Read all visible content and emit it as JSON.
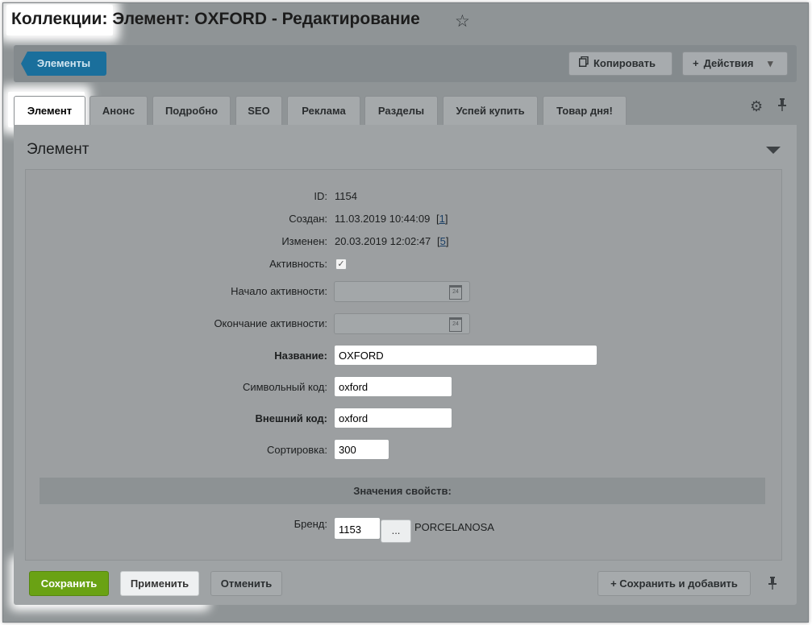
{
  "header": {
    "title_part1": "Коллекции:",
    "title_part2": " Элемент: OXFORD - Редактирование",
    "star_icon": "☆"
  },
  "toolbar": {
    "back_label": "Элементы",
    "copy_label": "Копировать",
    "actions_label": "Действия",
    "actions_arrow": "▾",
    "plus_icon": "+"
  },
  "tabs": [
    {
      "label": "Элемент",
      "active": true
    },
    {
      "label": "Анонс"
    },
    {
      "label": "Подробно"
    },
    {
      "label": "SEO"
    },
    {
      "label": "Реклама"
    },
    {
      "label": "Разделы"
    },
    {
      "label": "Успей купить"
    },
    {
      "label": "Товар дня!"
    }
  ],
  "panel": {
    "title": "Элемент"
  },
  "form": {
    "id_label": "ID:",
    "id_value": "1154",
    "created_label": "Создан:",
    "created_value": "11.03.2019 10:44:09",
    "created_link": "1",
    "modified_label": "Изменен:",
    "modified_value": "20.03.2019 12:02:47",
    "modified_link": "5",
    "active_label": "Активность:",
    "active_checked": true,
    "active_from_label": "Начало активности:",
    "active_from_value": "",
    "active_to_label": "Окончание активности:",
    "active_to_value": "",
    "calendar_day": "24",
    "name_label": "Название:",
    "name_value": "OXFORD",
    "code_label": "Символьный код:",
    "code_value": "oxford",
    "xml_id_label": "Внешний код:",
    "xml_id_value": "oxford",
    "sort_label": "Сортировка:",
    "sort_value": "300",
    "properties_section": "Значения свойств:",
    "brand_label": "Бренд:",
    "brand_value": "1153",
    "brand_button": "...",
    "brand_name": "PORCELANOSA"
  },
  "footer": {
    "save_label": "Сохранить",
    "apply_label": "Применить",
    "cancel_label": "Отменить",
    "save_add_label": "Сохранить и добавить"
  },
  "colors": {
    "overlay": "#8f9496",
    "save_green": "#6aa214",
    "back_button_blue": "#1a6f9c"
  }
}
